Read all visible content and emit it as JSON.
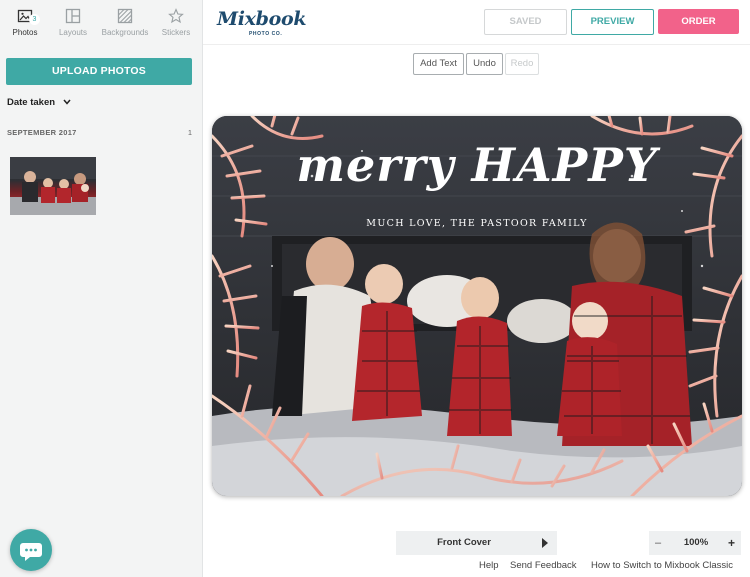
{
  "sidebar": {
    "tabs": [
      {
        "label": "Photos",
        "icon": "photo-icon",
        "badge": "3",
        "active": true
      },
      {
        "label": "Layouts",
        "icon": "layout-icon"
      },
      {
        "label": "Backgrounds",
        "icon": "background-icon"
      },
      {
        "label": "Stickers",
        "icon": "star-icon"
      }
    ],
    "upload_label": "UPLOAD PHOTOS",
    "sort_label": "Date taken",
    "group": {
      "title": "SEPTEMBER 2017",
      "count": "1"
    }
  },
  "header": {
    "logo": "Mixbook",
    "logo_sub": "PHOTO CO.",
    "saved_label": "SAVED",
    "preview_label": "PREVIEW",
    "order_label": "ORDER"
  },
  "toolbar": {
    "add_text": "Add Text",
    "undo": "Undo",
    "redo": "Redo"
  },
  "card": {
    "greeting": "merry HAPPY",
    "subtitle": "MUCH LOVE, THE PASTOOR FAMILY"
  },
  "footer": {
    "page_label": "Front Cover",
    "zoom_minus": "–",
    "zoom_value": "100%",
    "zoom_plus": "+",
    "links": [
      "Help",
      "Send Feedback",
      "How to Switch to Mixbook Classic"
    ]
  },
  "colors": {
    "accent": "#3fa9a5",
    "order": "#f2628a",
    "brand": "#1e4b6e"
  }
}
